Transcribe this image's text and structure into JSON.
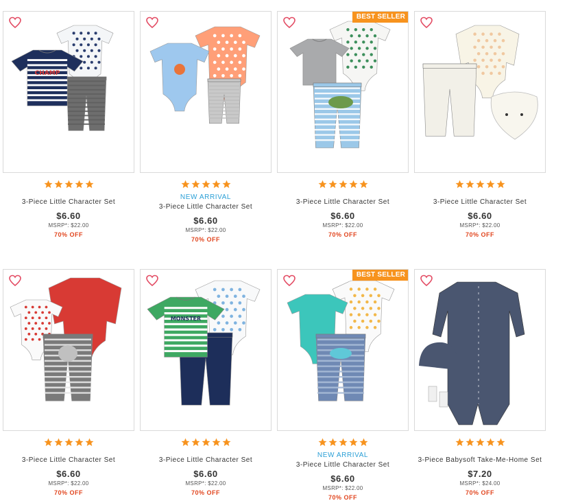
{
  "colors": {
    "accent_orange": "#f7931e",
    "discount_red": "#e1461f",
    "new_arrival_blue": "#2a9fd6",
    "heart_red": "#e34b63"
  },
  "products": [
    {
      "name": "3-Piece Little Character Set",
      "price": "$6.60",
      "msrp": "MSRP*: $22.00",
      "discount": "70% OFF",
      "rating": 5,
      "badge": "",
      "new_arrival": "",
      "image_icon": "navy-striped-tee-set"
    },
    {
      "name": "3-Piece Little Character Set",
      "price": "$6.60",
      "msrp": "MSRP*: $22.00",
      "discount": "70% OFF",
      "rating": 5,
      "badge": "",
      "new_arrival": "NEW ARRIVAL",
      "image_icon": "blue-crab-bodysuit-set"
    },
    {
      "name": "3-Piece Little Character Set",
      "price": "$6.60",
      "msrp": "MSRP*: $22.00",
      "discount": "70% OFF",
      "rating": 5,
      "badge": "BEST SELLER",
      "new_arrival": "",
      "image_icon": "dinosaur-set"
    },
    {
      "name": "3-Piece Little Character Set",
      "price": "$6.60",
      "msrp": "MSRP*: $22.00",
      "discount": "70% OFF",
      "rating": 5,
      "badge": "",
      "new_arrival": "",
      "image_icon": "cream-bear-bib-set"
    },
    {
      "name": "3-Piece Little Character Set",
      "price": "$6.60",
      "msrp": "MSRP*: $22.00",
      "discount": "70% OFF",
      "rating": 5,
      "badge": "",
      "new_arrival": "",
      "image_icon": "red-dog-set"
    },
    {
      "name": "3-Piece Little Character Set",
      "price": "$6.60",
      "msrp": "MSRP*: $22.00",
      "discount": "70% OFF",
      "rating": 5,
      "badge": "",
      "new_arrival": "",
      "image_icon": "green-monster-set"
    },
    {
      "name": "3-Piece Little Character Set",
      "price": "$6.60",
      "msrp": "MSRP*: $22.00",
      "discount": "70% OFF",
      "rating": 5,
      "badge": "BEST SELLER",
      "new_arrival": "NEW ARRIVAL",
      "image_icon": "teal-whale-set"
    },
    {
      "name": "3-Piece Babysoft Take-Me-Home Set",
      "price": "$7.20",
      "msrp": "MSRP*: $24.00",
      "discount": "70% OFF",
      "rating": 5,
      "badge": "",
      "new_arrival": "",
      "image_icon": "gray-sleeper-hat-set"
    }
  ]
}
